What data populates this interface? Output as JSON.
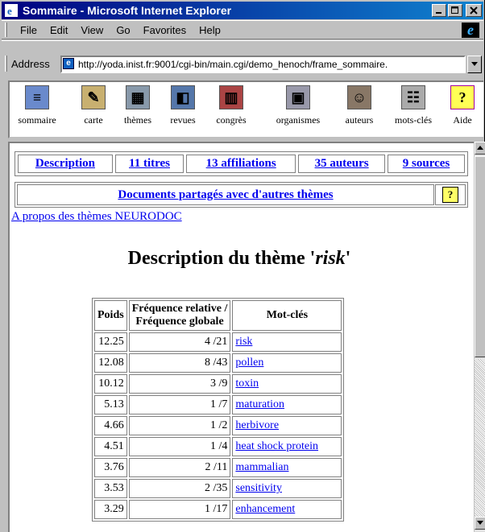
{
  "window": {
    "title": "Sommaire - Microsoft Internet Explorer"
  },
  "menu": [
    "File",
    "Edit",
    "View",
    "Go",
    "Favorites",
    "Help"
  ],
  "address": {
    "label": "Address",
    "url": "http://yoda.inist.fr:9001/cgi-bin/main.cgi/demo_henoch/frame_sommaire."
  },
  "toolbar": [
    {
      "label": "sommaire",
      "icon": "summary-icon",
      "color": "#6a8acc"
    },
    {
      "label": "carte",
      "icon": "map-icon",
      "color": "#c8b070"
    },
    {
      "label": "thèmes",
      "icon": "themes-icon",
      "color": "#8899aa"
    },
    {
      "label": "revues",
      "icon": "journals-icon",
      "color": "#5577aa"
    },
    {
      "label": "congrès",
      "icon": "books-icon",
      "color": "#aa4444"
    },
    {
      "label": "organismes",
      "icon": "organisations-icon",
      "color": "#9999aa"
    },
    {
      "label": "auteurs",
      "icon": "authors-icon",
      "color": "#887766"
    },
    {
      "label": "mots-clés",
      "icon": "keywords-icon",
      "color": "#aaaaaa"
    },
    {
      "label": "Aide",
      "icon": "help-icon",
      "color": "#ffff55"
    }
  ],
  "nav_links": {
    "description": "Description",
    "titres": "11 titres",
    "affiliations": "13 affiliations",
    "auteurs": "35 auteurs",
    "sources": "9 sources"
  },
  "shared_docs": "Documents partagés avec d'autres thèmes",
  "apropos": "A propos des thèmes NEURODOC",
  "heading": {
    "prefix": "Description du thème '",
    "theme": "risk",
    "suffix": "'"
  },
  "table": {
    "headers": {
      "poids": "Poids",
      "freq_line1": "Fréquence relative /",
      "freq_line2": "Fréquence globale",
      "motcles": "Mot-clés"
    },
    "rows": [
      {
        "poids": "12.25",
        "freq": "4 /21",
        "kw": "risk"
      },
      {
        "poids": "12.08",
        "freq": "8 /43",
        "kw": "pollen"
      },
      {
        "poids": "10.12",
        "freq": "3 /9",
        "kw": "toxin"
      },
      {
        "poids": "5.13",
        "freq": "1 /7",
        "kw": "maturation"
      },
      {
        "poids": "4.66",
        "freq": "1 /2",
        "kw": "herbivore"
      },
      {
        "poids": "4.51",
        "freq": "1 /4",
        "kw": "heat shock protein"
      },
      {
        "poids": "3.76",
        "freq": "2 /11",
        "kw": "mammalian"
      },
      {
        "poids": "3.53",
        "freq": "2 /35",
        "kw": "sensitivity"
      },
      {
        "poids": "3.29",
        "freq": "1 /17",
        "kw": "enhancement"
      }
    ]
  }
}
